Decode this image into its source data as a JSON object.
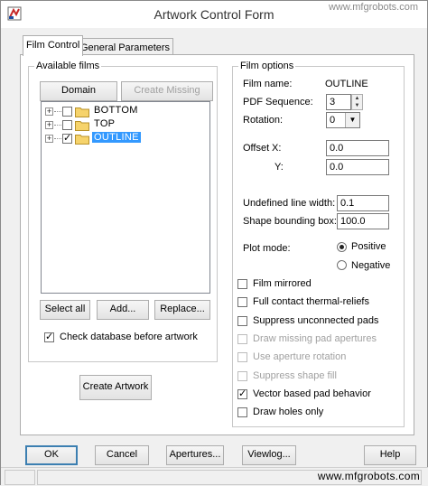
{
  "window": {
    "title": "Artwork Control Form"
  },
  "watermark_top": "www.mfgrobots.com",
  "watermark_bottom": "www.mfgrobots.com",
  "tabs": [
    {
      "label": "Film Control",
      "active": true
    },
    {
      "label": "General Parameters",
      "active": false
    }
  ],
  "available_films": {
    "legend": "Available films",
    "domain_selection": "Domain Selection",
    "create_missing": "Create Missing Films",
    "films": [
      {
        "name": "BOTTOM",
        "checked": false,
        "selected": false
      },
      {
        "name": "TOP",
        "checked": false,
        "selected": false
      },
      {
        "name": "OUTLINE",
        "checked": true,
        "selected": true
      }
    ],
    "select_all": "Select all",
    "add": "Add...",
    "replace": "Replace...",
    "check_db": {
      "label": "Check database before artwork",
      "checked": true
    },
    "create_artwork": "Create Artwork"
  },
  "film_options": {
    "legend": "Film options",
    "film_name_label": "Film name:",
    "film_name_value": "OUTLINE",
    "pdf_sequence_label": "PDF Sequence:",
    "pdf_sequence_value": "3",
    "rotation_label": "Rotation:",
    "rotation_value": "0",
    "offset_label": "Offset",
    "offset_x_label": "X:",
    "offset_x_value": "0.0",
    "offset_y_label": "Y:",
    "offset_y_value": "0.0",
    "undefined_line_width_label": "Undefined line width:",
    "undefined_line_width_value": "0.1",
    "shape_bounding_box_label": "Shape bounding box:",
    "shape_bounding_box_value": "100.0",
    "plot_mode_label": "Plot mode:",
    "plot_mode_options": [
      {
        "label": "Positive",
        "checked": true
      },
      {
        "label": "Negative",
        "checked": false
      }
    ],
    "options": [
      {
        "label": "Film mirrored",
        "checked": false,
        "disabled": false
      },
      {
        "label": "Full contact thermal-reliefs",
        "checked": false,
        "disabled": false
      },
      {
        "label": "Suppress unconnected pads",
        "checked": false,
        "disabled": false
      },
      {
        "label": "Draw missing pad apertures",
        "checked": false,
        "disabled": true
      },
      {
        "label": "Use aperture rotation",
        "checked": false,
        "disabled": true
      },
      {
        "label": "Suppress shape fill",
        "checked": false,
        "disabled": true
      },
      {
        "label": "Vector based pad behavior",
        "checked": true,
        "disabled": false
      },
      {
        "label": "Draw holes only",
        "checked": false,
        "disabled": false
      }
    ]
  },
  "bottom_buttons": {
    "ok": "OK",
    "cancel": "Cancel",
    "apertures": "Apertures...",
    "viewlog": "Viewlog...",
    "help": "Help"
  },
  "colors": {
    "selection": "#3399ff",
    "close_button": "#c7312a",
    "window_bg": "#f0f0f0"
  },
  "icons": {
    "app": "artwork-app-icon",
    "folder": "folder-icon",
    "expand": "plus-expander-icon"
  }
}
